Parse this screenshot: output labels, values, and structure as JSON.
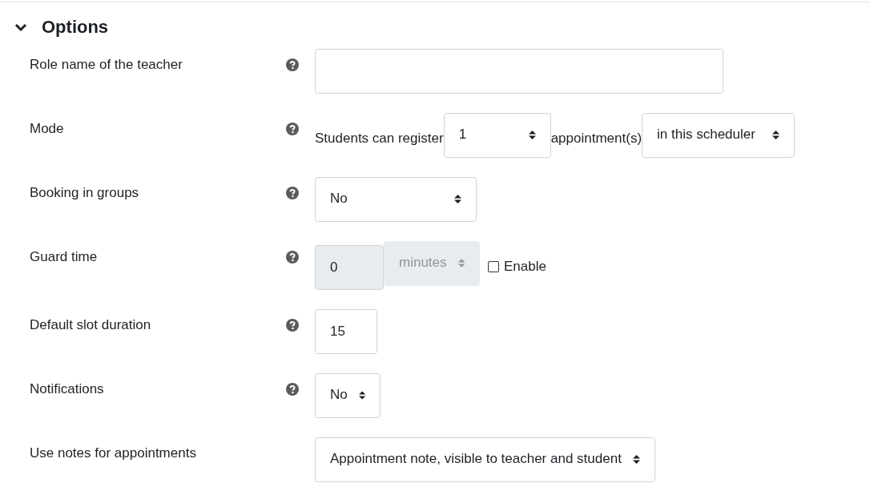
{
  "section": {
    "title": "Options",
    "expanded": true
  },
  "rows": [
    {
      "label": "Role name of the teacher",
      "help": true,
      "controls": [
        {
          "kind": "text",
          "disabled": false
        }
      ]
    },
    {
      "label": "Mode",
      "help": true,
      "controls": [
        {
          "kind": "label",
          "value": "Students can register"
        },
        {
          "kind": "select",
          "value": "1",
          "disabled": false
        },
        {
          "kind": "label",
          "value": "appointment(s)"
        },
        {
          "kind": "select",
          "value": "in this scheduler",
          "disabled": false
        }
      ]
    },
    {
      "label": "Booking in groups",
      "help": true,
      "controls": [
        {
          "kind": "select",
          "value": "No",
          "disabled": false
        }
      ]
    },
    {
      "label": "Guard time",
      "help": true,
      "controls": [
        {
          "kind": "text",
          "value": "0",
          "disabled": true
        },
        {
          "kind": "select",
          "value": "minutes",
          "disabled": true
        },
        {
          "kind": "checkbox",
          "value": "Enable",
          "checked": false
        }
      ]
    },
    {
      "label": "Default slot duration",
      "help": true,
      "controls": [
        {
          "kind": "text",
          "value": "15",
          "disabled": false
        }
      ]
    },
    {
      "label": "Notifications",
      "help": true,
      "controls": [
        {
          "kind": "select",
          "value": "No",
          "disabled": false
        }
      ]
    },
    {
      "label": "Use notes for appointments",
      "help": false,
      "controls": [
        {
          "kind": "select",
          "value": "Appointment note, visible to teacher and student",
          "disabled": false
        }
      ]
    }
  ]
}
